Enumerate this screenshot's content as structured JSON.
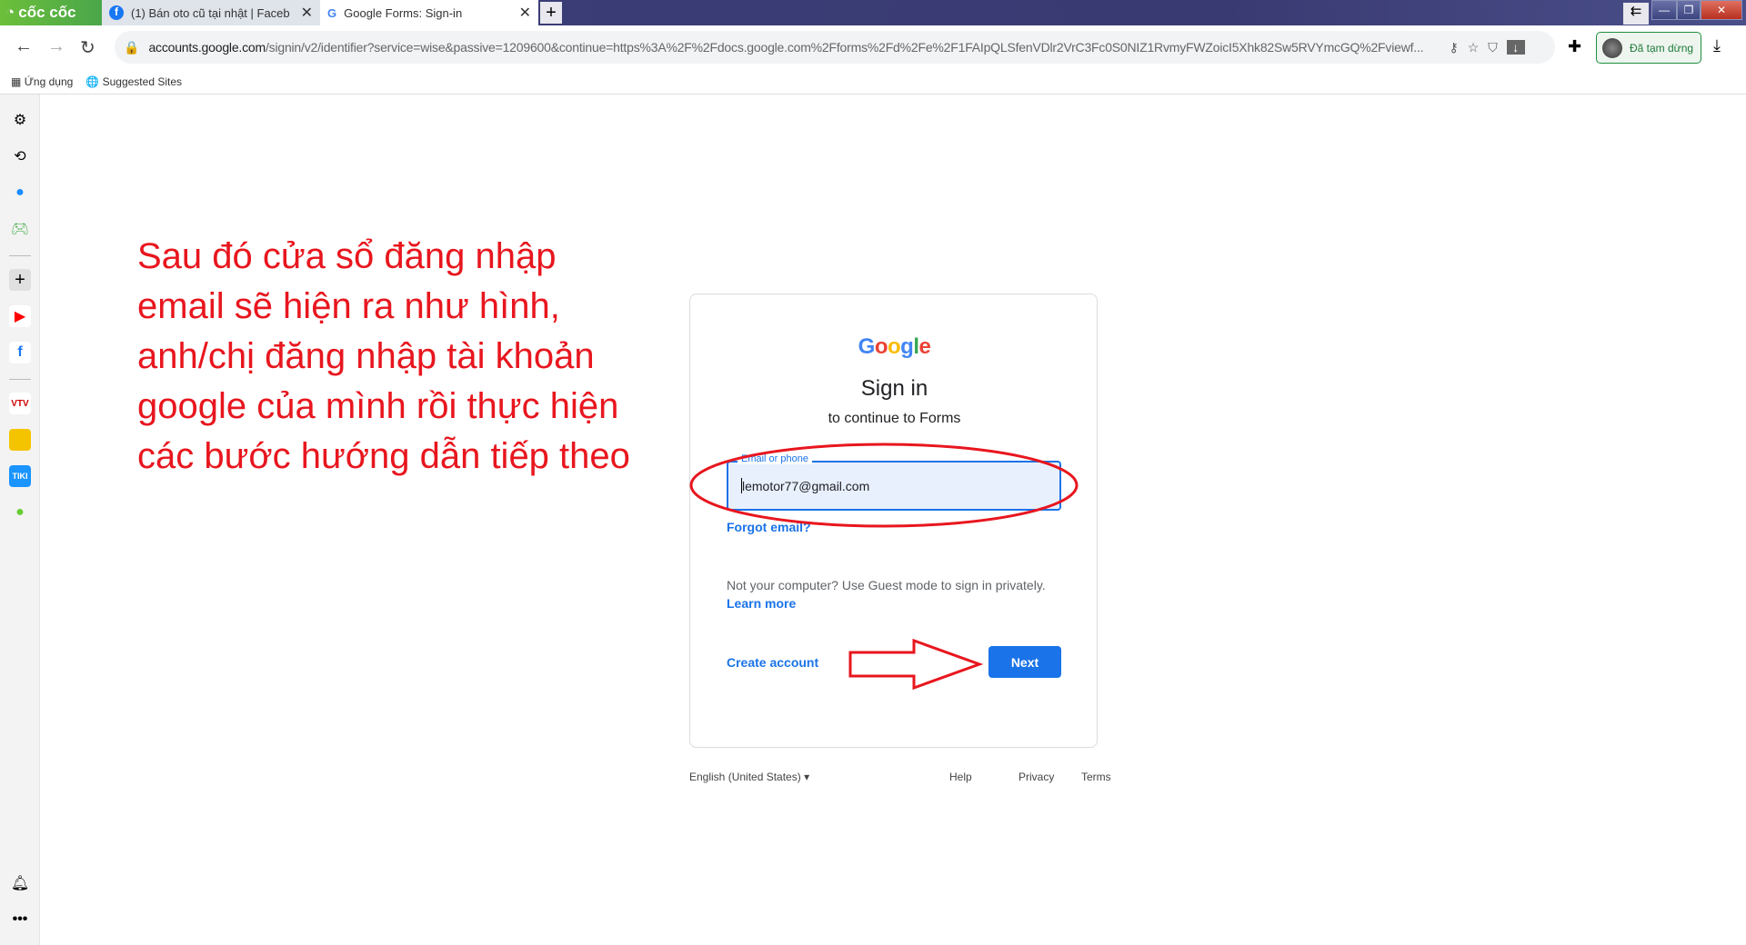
{
  "browser": {
    "brand": "cốc cốc",
    "tabs": [
      {
        "label": "(1) Bán oto cũ tại nhật | Faceb",
        "icon": "facebook-icon"
      },
      {
        "label": "Google Forms: Sign-in",
        "icon": "google-icon",
        "active": true
      }
    ],
    "url_host": "accounts.google.com",
    "url_rest": "/signin/v2/identifier?service=wise&passive=1209600&continue=https%3A%2F%2Fdocs.google.com%2Fforms%2Fd%2Fe%2F1FAIpQLSfenVDlr2VrC3Fc0S0NIZ1RvmyFWZoicI5Xhk82Sw5RVYmcGQ%2Fviewf...",
    "profile_status": "Đã tạm dừng",
    "bookmarks": [
      {
        "label": "Ứng dụng"
      },
      {
        "label": "Suggested Sites"
      }
    ]
  },
  "instruction": "Sau đó cửa sổ đăng nhập email sẽ hiện ra như hình, anh/chị đăng nhập tài khoản google của mình rồi thực hiện các bước hướng dẫn tiếp theo",
  "signin": {
    "logo": "Google",
    "title": "Sign in",
    "subtitle": "to continue to Forms",
    "field_label": "Email or phone",
    "field_value": "lemotor77@gmail.com",
    "forgot": "Forgot email?",
    "guest_note": "Not your computer? Use Guest mode to sign in privately.",
    "learn_more": "Learn more",
    "create_account": "Create account",
    "next": "Next"
  },
  "footer": {
    "language": "English (United States)",
    "help": "Help",
    "privacy": "Privacy",
    "terms": "Terms"
  },
  "colors": {
    "accent": "#1a73e8",
    "annotation": "#e8161e"
  }
}
